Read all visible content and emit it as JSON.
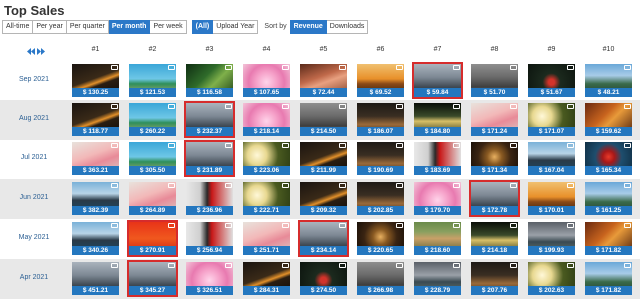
{
  "page": {
    "title": "Top Sales"
  },
  "filters": {
    "period_buttons": [
      {
        "label": "All-time",
        "active": false
      },
      {
        "label": "Per year",
        "active": false
      },
      {
        "label": "Per quarter",
        "active": false
      },
      {
        "label": "Per month",
        "active": true
      },
      {
        "label": "Per week",
        "active": false
      }
    ],
    "year_buttons": [
      {
        "label": "(All)",
        "active": true
      },
      {
        "label": "Upload Year",
        "active": false
      }
    ],
    "sort_label": "Sort by",
    "sort_buttons": [
      {
        "label": "Revenue",
        "active": true
      },
      {
        "label": "Downloads",
        "active": false
      }
    ]
  },
  "table": {
    "ranks": [
      "#1",
      "#2",
      "#3",
      "#4",
      "#5",
      "#6",
      "#7",
      "#8",
      "#9",
      "#10"
    ],
    "rows": [
      {
        "month": "Sep 2021",
        "cells": [
          {
            "price": "$ 130.25",
            "scene": "light-trails",
            "highlight": false
          },
          {
            "price": "$ 121.53",
            "scene": "palm-beach",
            "highlight": false
          },
          {
            "price": "$ 116.58",
            "scene": "greenery",
            "highlight": false
          },
          {
            "price": "$ 107.65",
            "scene": "pink-flower",
            "highlight": false
          },
          {
            "price": "$ 72.44",
            "scene": "heart-hands",
            "highlight": false
          },
          {
            "price": "$ 69.52",
            "scene": "sunset-field",
            "highlight": false
          },
          {
            "price": "$ 59.84",
            "scene": "city-skyline",
            "highlight": true
          },
          {
            "price": "$ 51.70",
            "scene": "road-hills",
            "highlight": false
          },
          {
            "price": "$ 51.67",
            "scene": "red-coat-forest",
            "highlight": false
          },
          {
            "price": "$ 48.21",
            "scene": "mountain-lake",
            "highlight": false
          }
        ]
      },
      {
        "month": "Aug 2021",
        "cells": [
          {
            "price": "$ 118.77",
            "scene": "light-trails",
            "highlight": false
          },
          {
            "price": "$ 260.22",
            "scene": "palm-beach",
            "highlight": false
          },
          {
            "price": "$ 232.37",
            "scene": "city-skyline",
            "highlight": true
          },
          {
            "price": "$ 218.14",
            "scene": "pink-flower",
            "highlight": false
          },
          {
            "price": "$ 214.50",
            "scene": "road-hills",
            "highlight": false
          },
          {
            "price": "$ 186.07",
            "scene": "desert-arch",
            "highlight": false
          },
          {
            "price": "$ 184.80",
            "scene": "forest-sun",
            "highlight": false
          },
          {
            "price": "$ 171.24",
            "scene": "flamingo",
            "highlight": false
          },
          {
            "price": "$ 171.07",
            "scene": "white-flowers",
            "highlight": false
          },
          {
            "price": "$ 159.62",
            "scene": "autumn-leaves",
            "highlight": false
          }
        ]
      },
      {
        "month": "Jul 2021",
        "cells": [
          {
            "price": "$ 363.21",
            "scene": "flamingo",
            "highlight": false
          },
          {
            "price": "$ 305.50",
            "scene": "palm-beach",
            "highlight": false
          },
          {
            "price": "$ 231.89",
            "scene": "city-skyline",
            "highlight": true
          },
          {
            "price": "$ 223.06",
            "scene": "white-flowers",
            "highlight": false
          },
          {
            "price": "$ 211.99",
            "scene": "light-trails",
            "highlight": false
          },
          {
            "price": "$ 190.69",
            "scene": "desert-arch",
            "highlight": false
          },
          {
            "price": "$ 183.69",
            "scene": "couple-red",
            "highlight": false
          },
          {
            "price": "$ 171.34",
            "scene": "railway-tunnel",
            "highlight": false
          },
          {
            "price": "$ 167.04",
            "scene": "sea-cliffs",
            "highlight": false
          },
          {
            "price": "$ 165.34",
            "scene": "red-tree",
            "highlight": false
          }
        ]
      },
      {
        "month": "Jun 2021",
        "cells": [
          {
            "price": "$ 382.39",
            "scene": "sea-cliffs",
            "highlight": false
          },
          {
            "price": "$ 264.89",
            "scene": "flamingo",
            "highlight": false
          },
          {
            "price": "$ 236.96",
            "scene": "couple-red",
            "highlight": false
          },
          {
            "price": "$ 222.71",
            "scene": "white-flowers",
            "highlight": false
          },
          {
            "price": "$ 209.32",
            "scene": "light-trails",
            "highlight": false
          },
          {
            "price": "$ 202.85",
            "scene": "desert-arch",
            "highlight": false
          },
          {
            "price": "$ 179.70",
            "scene": "pink-flower",
            "highlight": false
          },
          {
            "price": "$ 172.78",
            "scene": "city-skyline",
            "highlight": true
          },
          {
            "price": "$ 170.01",
            "scene": "sunset-field",
            "highlight": false
          },
          {
            "price": "$ 161.25",
            "scene": "mountain-lake",
            "highlight": false
          }
        ]
      },
      {
        "month": "May 2021",
        "cells": [
          {
            "price": "$ 340.26",
            "scene": "sea-cliffs",
            "highlight": false
          },
          {
            "price": "$ 270.91",
            "scene": "red-poster",
            "highlight": true
          },
          {
            "price": "$ 256.94",
            "scene": "couple-red",
            "highlight": false
          },
          {
            "price": "$ 251.71",
            "scene": "flamingo",
            "highlight": false
          },
          {
            "price": "$ 234.14",
            "scene": "city-skyline",
            "highlight": true
          },
          {
            "price": "$ 220.65",
            "scene": "railway-tunnel",
            "highlight": false
          },
          {
            "price": "$ 218.60",
            "scene": "dog",
            "highlight": false
          },
          {
            "price": "$ 214.18",
            "scene": "forest-sun",
            "highlight": false
          },
          {
            "price": "$ 199.93",
            "scene": "storm-sea",
            "highlight": false
          },
          {
            "price": "$ 171.82",
            "scene": "autumn-leaves",
            "highlight": false
          }
        ]
      },
      {
        "month": "Apr 2021",
        "cells": [
          {
            "price": "$ 451.21",
            "scene": "city-skyline",
            "highlight": false
          },
          {
            "price": "$ 345.27",
            "scene": "city-skyline",
            "highlight": true
          },
          {
            "price": "$ 326.51",
            "scene": "pink-flower",
            "highlight": false
          },
          {
            "price": "$ 284.31",
            "scene": "light-trails",
            "highlight": false
          },
          {
            "price": "$ 274.50",
            "scene": "red-coat-forest",
            "highlight": false
          },
          {
            "price": "$ 266.98",
            "scene": "road-hills",
            "highlight": false
          },
          {
            "price": "$ 228.79",
            "scene": "storm-sea",
            "highlight": false
          },
          {
            "price": "$ 207.76",
            "scene": "desert-arch",
            "highlight": false
          },
          {
            "price": "$ 202.63",
            "scene": "white-flowers",
            "highlight": false
          },
          {
            "price": "$ 171.82",
            "scene": "mountain-lake",
            "highlight": false
          }
        ]
      }
    ]
  },
  "colors": {
    "accent": "#2b78c8",
    "price_bar": "#2477bf",
    "highlight_border": "#d62c2c",
    "row_alt": "#e8e8e8",
    "month_text": "#2b5f93"
  }
}
